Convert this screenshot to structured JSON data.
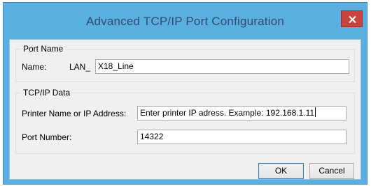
{
  "window": {
    "title": "Advanced TCP/IP Port Configuration",
    "close_icon": "close-icon"
  },
  "port_name_group": {
    "legend": "Port Name",
    "name_label": "Name:",
    "name_prefix": "LAN_",
    "name_value": "X18_Line"
  },
  "tcpip_group": {
    "legend": "TCP/IP Data",
    "address_label": "Printer Name or IP Address:",
    "address_value": "Enter printer IP adress. Example: 192.168.1.11",
    "port_label": "Port Number:",
    "port_value": "14322"
  },
  "buttons": {
    "ok_label": "OK",
    "cancel_label": "Cancel"
  },
  "colors": {
    "titlebar": "#5aafe0",
    "close_button": "#c9443c",
    "dialog_background": "#f0f0f0"
  }
}
